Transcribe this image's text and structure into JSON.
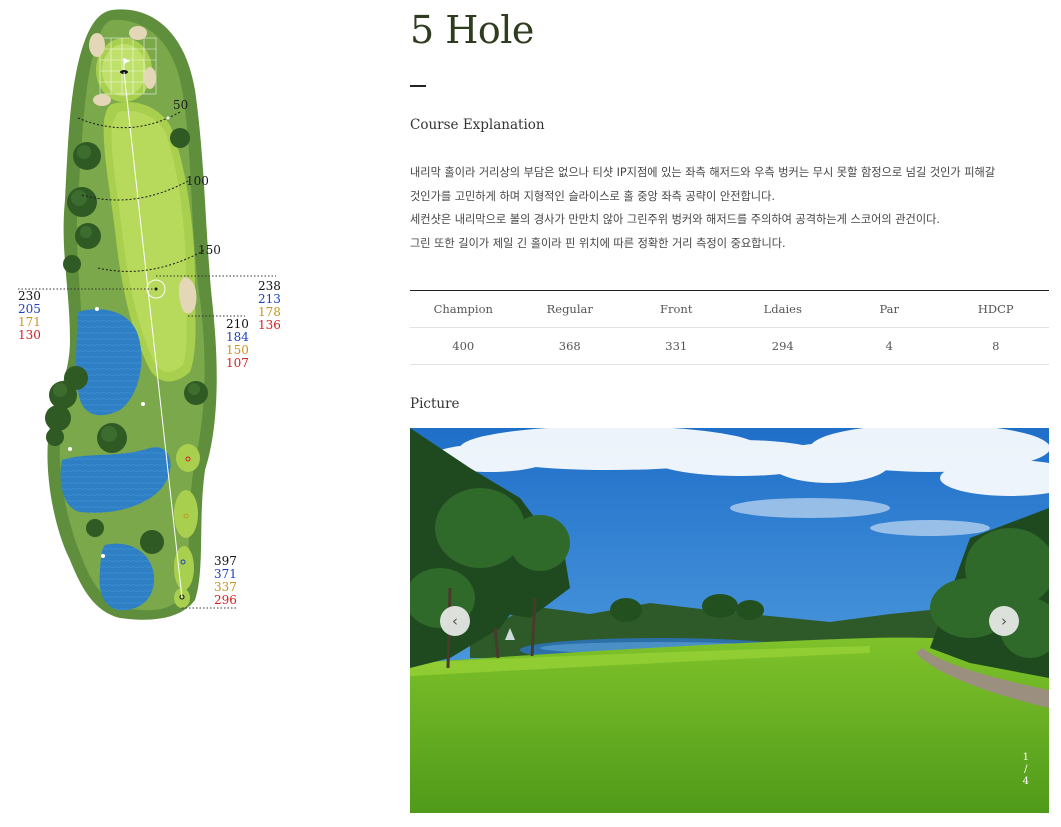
{
  "hole": {
    "title": "5 Hole"
  },
  "course_explanation": {
    "label": "Course Explanation",
    "lines": [
      "내리막 홀이라 거리상의 부담은 없으나 티샷 IP지점에 있는 좌측 해저드와 우측 벙커는 무시 못할 함정으로 넘길 것인가 피해갈",
      "것인가를 고민하게 하며 지형적인 슬라이스로 홀 중앙 좌측 공략이 안전합니다.",
      "세컨샷은 내리막으로 볼의 경사가 만만치 않아 그린주위 벙커와 해저드를 주의하여 공격하는게 스코어의 관건이다.",
      "그린 또한 길이가 제일 긴 홀이라 핀 위치에 따른 정확한 거리 측정이 중요합니다."
    ]
  },
  "scorecard": {
    "headers": [
      "Champion",
      "Regular",
      "Front",
      "Ldaies",
      "Par",
      "HDCP"
    ],
    "values": [
      "400",
      "368",
      "331",
      "294",
      "4",
      "8"
    ]
  },
  "picture": {
    "label": "Picture",
    "page_current": "1",
    "page_sep": "/",
    "page_total": "4"
  },
  "map": {
    "distance_markers": [
      "50",
      "100",
      "150"
    ],
    "left_yardage": [
      "230",
      "205",
      "171",
      "130"
    ],
    "right_top_yardage": [
      "238",
      "213",
      "178",
      "136"
    ],
    "right_mid_yardage": [
      "210",
      "184",
      "150",
      "107"
    ],
    "tee_yardage": [
      "397",
      "371",
      "337",
      "296"
    ],
    "tee_colors": [
      "#111111",
      "#1f3fbf",
      "#c8961e",
      "#d42020"
    ]
  },
  "colors": {
    "title": "#2e3d20",
    "rough": "#5f8f3c",
    "fairway": "#a9cf4e",
    "water": "#2f7fc4"
  }
}
